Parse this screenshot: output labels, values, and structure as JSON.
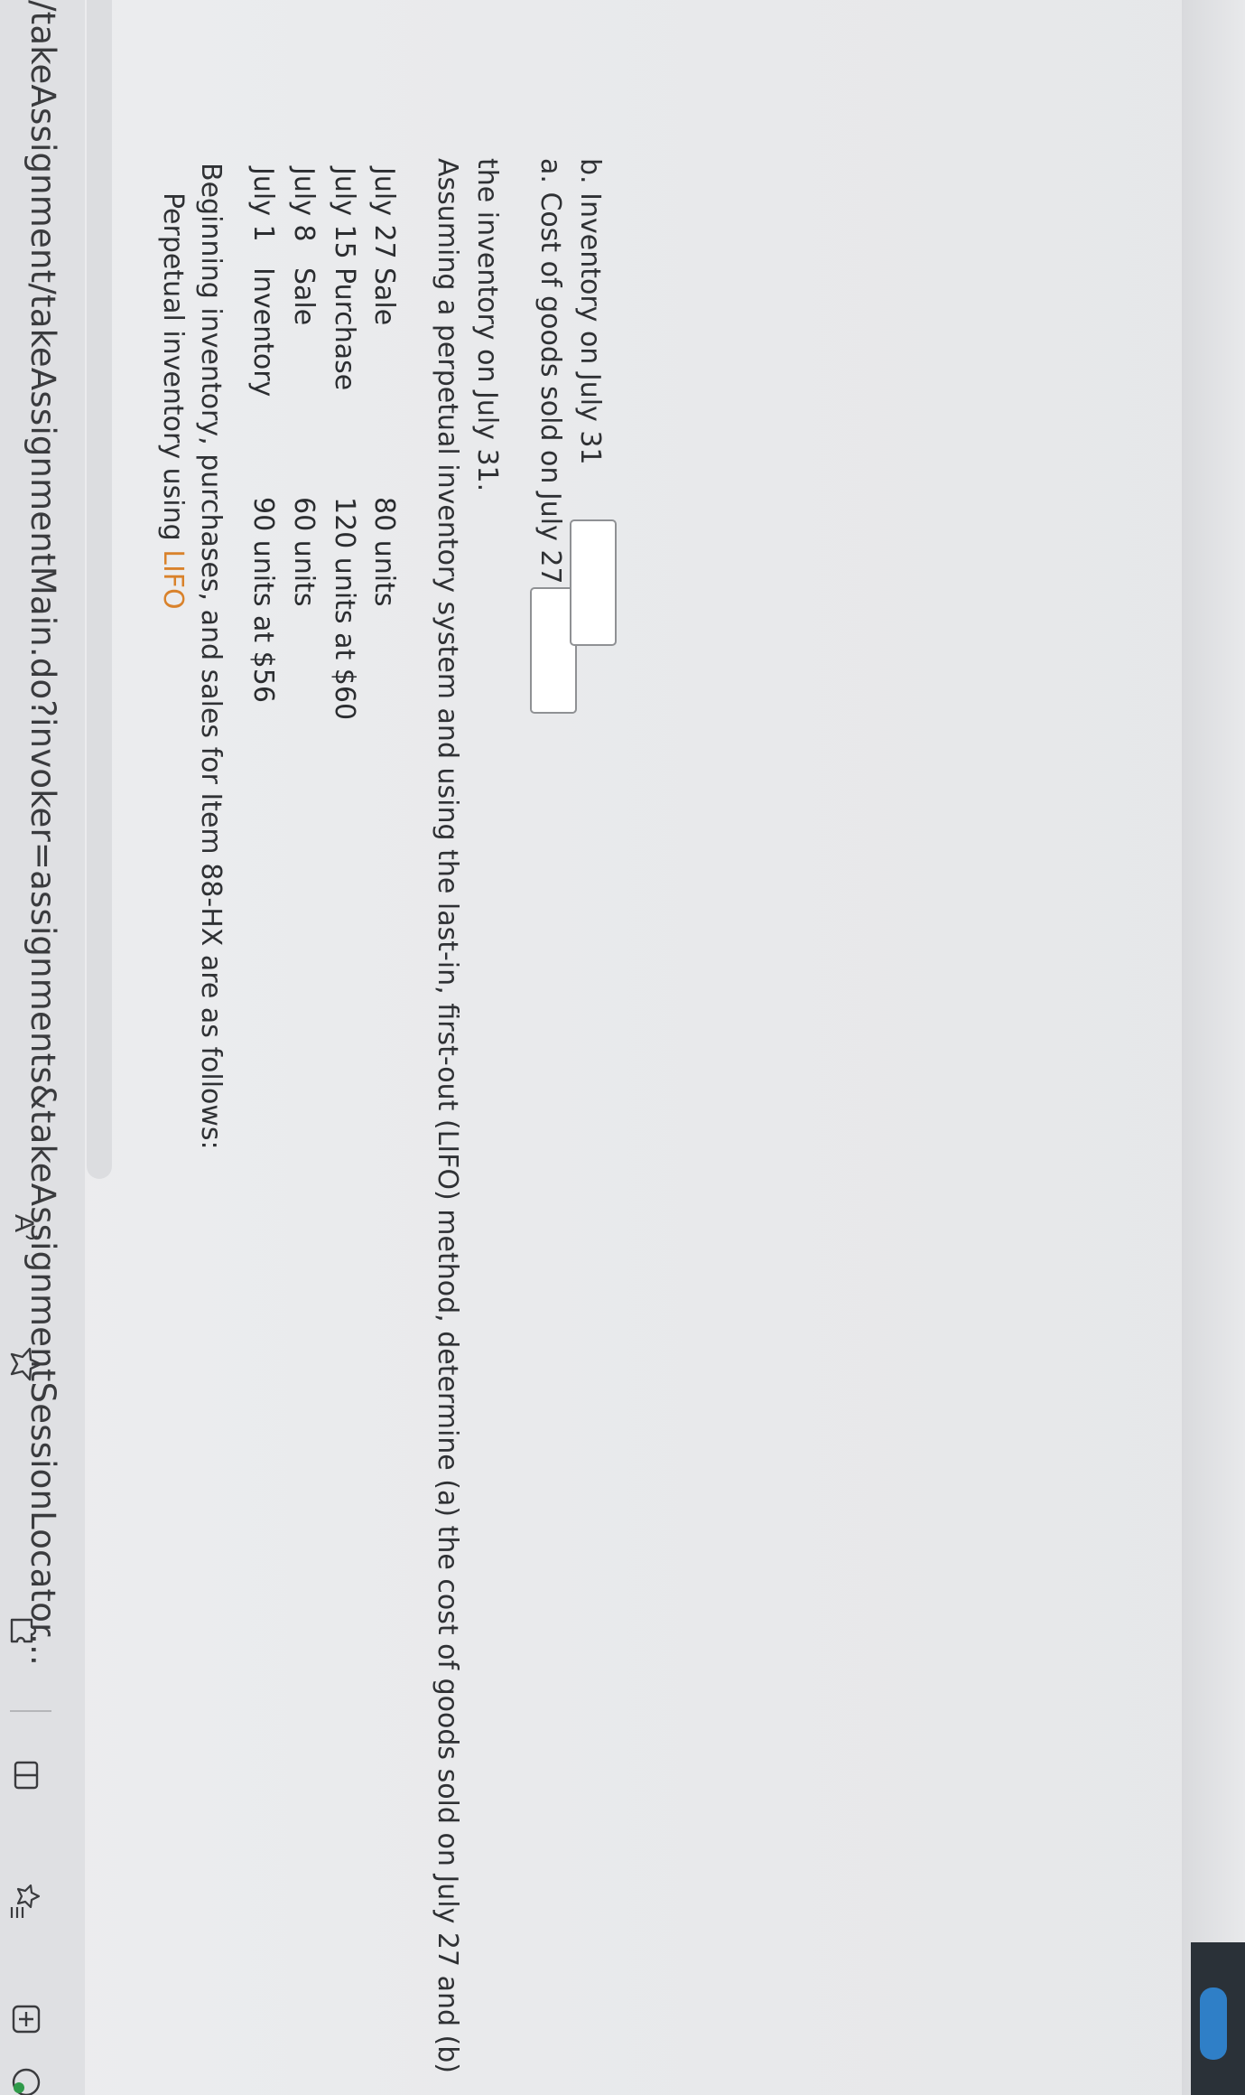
{
  "browser": {
    "url": "/takeAssignment/takeAssignmentMain.do?invoker=assignments&takeAssignmentSessionLocator...",
    "toolbar_icons": [
      "read-aloud-icon",
      "favorite-star-icon",
      "extensions-puzzle-icon",
      "split-screen-icon",
      "favorites-list-icon",
      "collections-icon",
      "profile-icon"
    ]
  },
  "problem": {
    "title_prefix": "Perpetual inventory using ",
    "title_method": "LIFO",
    "intro": "Beginning inventory, purchases, and sales for Item 88-HX are as follows:",
    "transactions": [
      {
        "date": "July 1",
        "type": "Inventory",
        "amount": "90 units at $56"
      },
      {
        "date": "July 8",
        "type": "Sale",
        "amount": "60 units"
      },
      {
        "date": "July 15",
        "type": "Purchase",
        "amount": "120 units at $60"
      },
      {
        "date": "July 27",
        "type": "Sale",
        "amount": "80 units"
      }
    ],
    "question_line1": "Assuming a perpetual inventory system and using the last-in, first-out (LIFO) method, determine (a) the cost of goods sold on July 27 and (b)",
    "question_line2": "the inventory on July 31.",
    "part_a_label": "a. Cost of goods sold on July 27",
    "part_a_value": "",
    "part_b_label": "b. Inventory on July 31",
    "part_b_value": ""
  },
  "colors": {
    "accent_lifo": "#d9822b",
    "text": "#2f3134",
    "background": "#ecedef"
  }
}
